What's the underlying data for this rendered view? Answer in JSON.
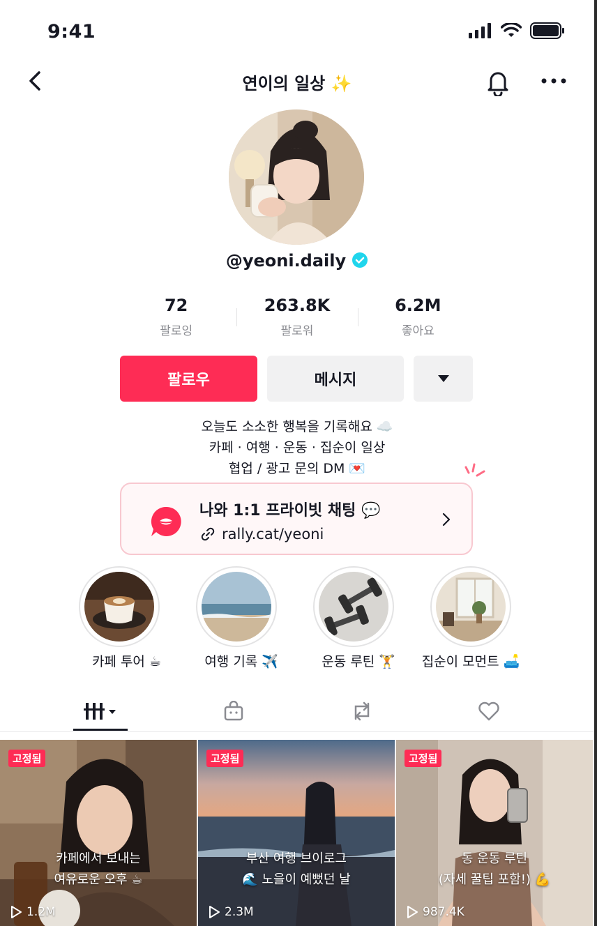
{
  "status_bar": {
    "time": "9:41"
  },
  "header": {
    "title": "연이의 일상 ✨"
  },
  "profile": {
    "handle": "@yeoni.daily",
    "stats": [
      {
        "value": "72",
        "label": "팔로잉"
      },
      {
        "value": "263.8K",
        "label": "팔로워"
      },
      {
        "value": "6.2M",
        "label": "좋아요"
      }
    ],
    "follow_label": "팔로우",
    "message_label": "메시지",
    "bio": [
      "오늘도 소소한 행복을 기록해요 ☁️",
      "카페 · 여행 · 운동 · 집순이 일상",
      "협업 / 광고 문의 DM 💌"
    ]
  },
  "link_card": {
    "title": "나와 1:1 프라이빗 채팅 💬",
    "url": "rally.cat/yeoni"
  },
  "highlights": [
    {
      "label": "카페 투어 ☕"
    },
    {
      "label": "여행 기록 ✈️"
    },
    {
      "label": "운동 루틴 🏋️"
    },
    {
      "label": "집순이 모먼트 🛋️"
    }
  ],
  "videos": [
    {
      "pinned": "고정됨",
      "caption_1": "카페에서 보내는",
      "caption_2": "여유로운 오후 ☕",
      "views": "1.2M"
    },
    {
      "pinned": "고정됨",
      "caption_1": "부산 여행 브이로그",
      "caption_2": "🌊 노을이 예뻤던 날",
      "views": "2.3M"
    },
    {
      "pinned": "고정됨",
      "caption_1": "동 운동 루틴",
      "caption_2": "(자세 꿀팁 포함!) 💪",
      "views": "987.4K"
    }
  ],
  "colors": {
    "accent": "#fe2c55",
    "verified": "#20d5ec",
    "secondary_btn": "#f1f1f2"
  }
}
